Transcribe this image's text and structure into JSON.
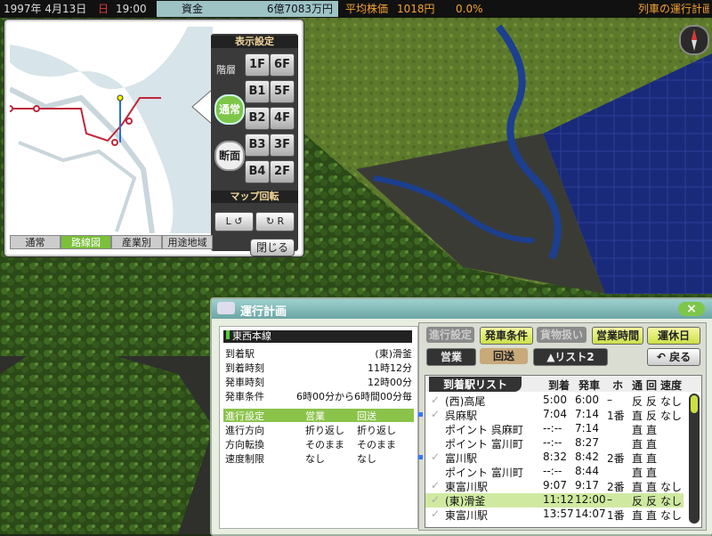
{
  "topbar": {
    "date": "1997年 4月13日",
    "weekday": "日",
    "time": "19:00",
    "funds_label": "資金",
    "funds_value": "6億7083万円",
    "stock_label": "平均株価",
    "stock_value": "1018円",
    "stock_change": "0.0%",
    "plan_label": "列車の運行計画"
  },
  "map_window": {
    "settings_title": "表示設定",
    "floor_label": "階層",
    "floors": [
      "1F",
      "6F",
      "B1",
      "5F",
      "B2",
      "4F",
      "B3",
      "3F",
      "B4",
      "2F"
    ],
    "normal_btn": "通常",
    "section_btn": "断面",
    "rotate_title": "マップ回転",
    "rot_left": "L",
    "rot_right": "R",
    "close_btn": "閉じる",
    "tabs": [
      "通常",
      "路線図",
      "産業別",
      "用途地域"
    ],
    "active_tab": 1
  },
  "plan": {
    "title": "運行計画",
    "close": "×",
    "line_name": "東西本線",
    "rows": [
      {
        "k": "到着駅",
        "v": "(東)滑釜"
      },
      {
        "k": "到着時刻",
        "v": "11時12分"
      },
      {
        "k": "発車時刻",
        "v": "12時00分"
      },
      {
        "k": "発車条件",
        "v": "6時00分から6時間00分毎"
      }
    ],
    "settings_header": {
      "k": "進行設定",
      "a": "営業",
      "b": "回送"
    },
    "settings_rows": [
      {
        "k": "進行方向",
        "a": "折り返し",
        "b": "折り返し"
      },
      {
        "k": "方向転換",
        "a": "そのまま",
        "b": "そのまま"
      },
      {
        "k": "速度制限",
        "a": "なし",
        "b": "なし"
      }
    ],
    "tabs": [
      "進行設定",
      "発車条件",
      "貨物扱い",
      "営業時間",
      "運休日"
    ],
    "mode_business": "営業",
    "mode_deadhead": "回送",
    "list2": "▲リスト2",
    "back": "戻る",
    "list_title": "到着駅リスト",
    "cols": [
      "到着",
      "発車",
      "ホ",
      "通",
      "回",
      "速度"
    ],
    "stations": [
      {
        "name": "(西)高尾",
        "arr": "5:00",
        "dep": "6:00",
        "plat": "–",
        "a": "反",
        "b": "反",
        "spd": "なし",
        "mark": false,
        "check": true
      },
      {
        "name": "呉麻駅",
        "arr": "7:04",
        "dep": "7:14",
        "plat": "1番",
        "a": "直",
        "b": "反",
        "spd": "なし",
        "mark": true,
        "check": true
      },
      {
        "name": "ポイント 呉麻町",
        "arr": "--:--",
        "dep": "7:14",
        "plat": "",
        "a": "直",
        "b": "直",
        "spd": "",
        "mark": false,
        "check": false
      },
      {
        "name": "ポイント 富川町",
        "arr": "--:--",
        "dep": "8:27",
        "plat": "",
        "a": "直",
        "b": "直",
        "spd": "",
        "mark": false,
        "check": false
      },
      {
        "name": "富川駅",
        "arr": "8:32",
        "dep": "8:42",
        "plat": "2番",
        "a": "直",
        "b": "直",
        "spd": "",
        "mark": true,
        "check": true
      },
      {
        "name": "ポイント 富川町",
        "arr": "--:--",
        "dep": "8:44",
        "plat": "",
        "a": "直",
        "b": "直",
        "spd": "",
        "mark": false,
        "check": false
      },
      {
        "name": "東富川駅",
        "arr": "9:07",
        "dep": "9:17",
        "plat": "2番",
        "a": "直",
        "b": "直",
        "spd": "なし",
        "mark": false,
        "check": true
      },
      {
        "name": "(東)滑釜",
        "arr": "11:12",
        "dep": "12:00",
        "plat": "–",
        "a": "反",
        "b": "反",
        "spd": "なし",
        "mark": false,
        "check": true,
        "sel": true
      },
      {
        "name": "東富川駅",
        "arr": "13:57",
        "dep": "14:07",
        "plat": "1番",
        "a": "直",
        "b": "直",
        "spd": "なし",
        "mark": false,
        "check": true
      }
    ]
  }
}
